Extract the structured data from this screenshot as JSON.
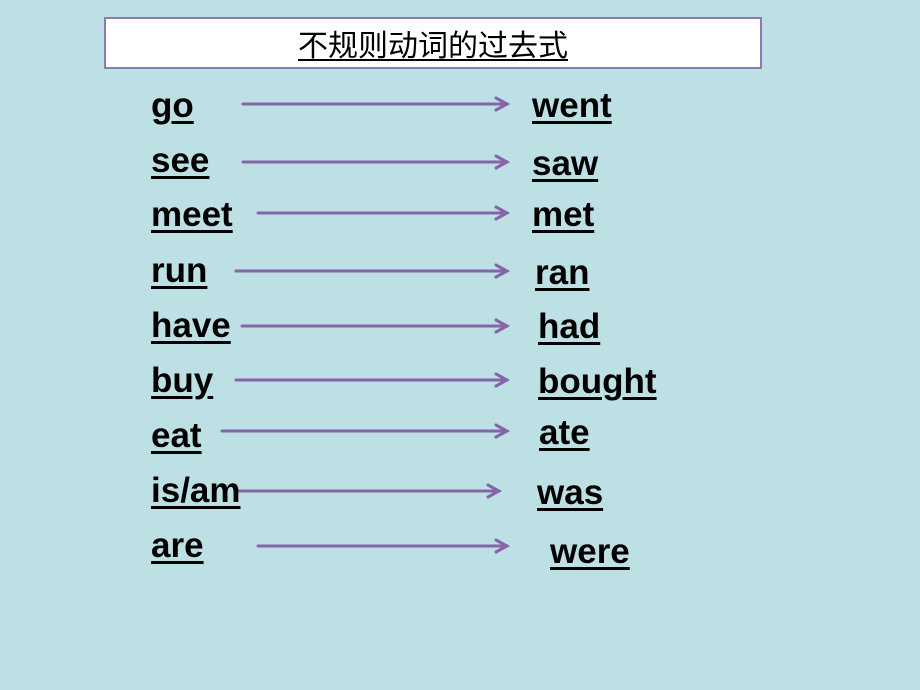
{
  "title": "不规则动词的过去式",
  "arrow_color": "#8466a8",
  "pairs": [
    {
      "base": "go",
      "past": "went"
    },
    {
      "base": "see",
      "past": "saw"
    },
    {
      "base": "meet",
      "past": "met"
    },
    {
      "base": "run",
      "past": "ran"
    },
    {
      "base": "have",
      "past": "had"
    },
    {
      "base": "buy",
      "past": "bought"
    },
    {
      "base": "eat",
      "past": "ate"
    },
    {
      "base": "is/am",
      "past": "was"
    },
    {
      "base": "are",
      "past": "were"
    }
  ]
}
